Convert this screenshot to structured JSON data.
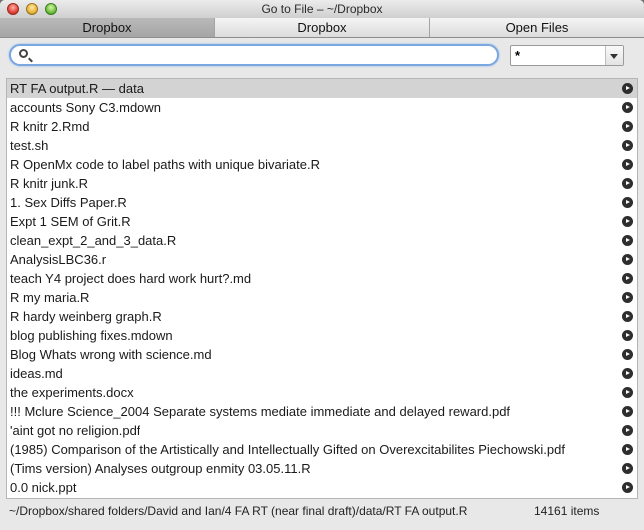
{
  "window": {
    "title": "Go to File – ~/Dropbox"
  },
  "tabs": [
    {
      "label": "Dropbox"
    },
    {
      "label": "Dropbox"
    },
    {
      "label": "Open Files"
    }
  ],
  "search": {
    "value": "",
    "placeholder": ""
  },
  "filter": {
    "value": "*"
  },
  "files": [
    "RT FA output.R — data",
    "accounts Sony C3.mdown",
    "R knitr 2.Rmd",
    "test.sh",
    "R OpenMx code to label paths with unique bivariate.R",
    "R knitr junk.R",
    "1. Sex Diffs Paper.R",
    "Expt 1 SEM of Grit.R",
    "clean_expt_2_and_3_data.R",
    "AnalysisLBC36.r",
    "teach Y4 project does hard work hurt?.md",
    "R my maria.R",
    "R hardy weinberg graph.R",
    "blog publishing fixes.mdown",
    "Blog Whats wrong with science.md",
    "ideas.md",
    " the experiments.docx",
    "!!! Mclure Science_2004 Separate systems mediate immediate and delayed reward.pdf",
    "'aint got no religion.pdf",
    "(1985) Comparison of the Artistically and Intellectually Gifted on Overexcitabilites Piechowski.pdf",
    "(Tims version) Analyses outgroup enmity 03.05.11.R",
    "0.0 nick.ppt"
  ],
  "status": {
    "path": "~/Dropbox/shared folders/David and Ian/4 FA RT (near final draft)/data/RT FA output.R",
    "count": "14161 items"
  }
}
